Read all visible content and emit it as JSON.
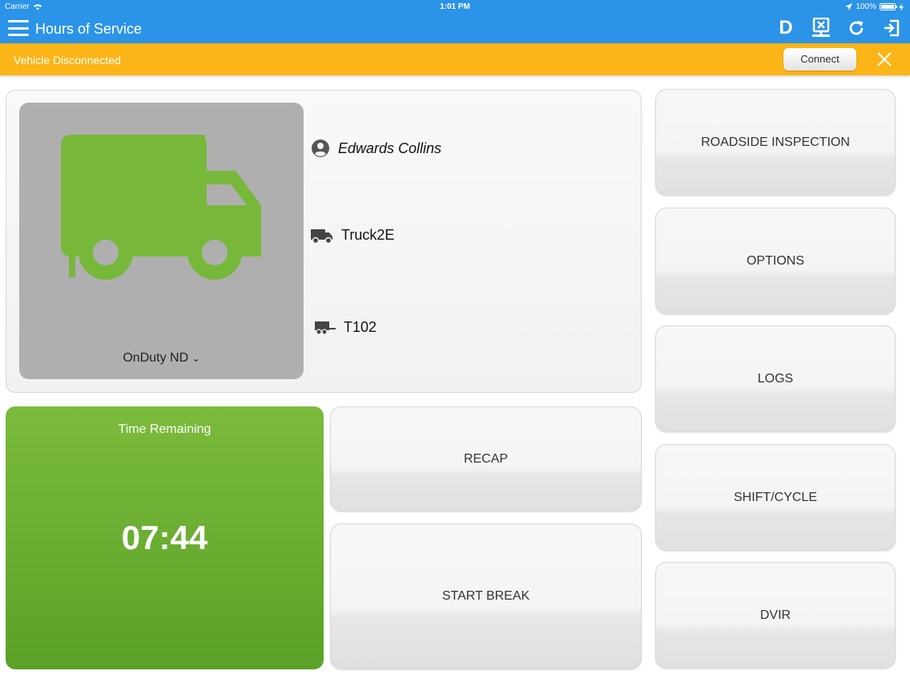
{
  "status_bar": {
    "carrier": "Carrier",
    "time": "1:01 PM",
    "battery": "100%"
  },
  "app_bar": {
    "title": "Hours of Service",
    "icons": [
      "menu-icon",
      "d-icon",
      "disconnect-device-icon",
      "refresh-icon",
      "logout-icon"
    ],
    "d_label": "D"
  },
  "banner": {
    "message": "Vehicle Disconnected",
    "connect_label": "Connect",
    "color": "#fbb517"
  },
  "driver_card": {
    "duty_status": "OnDuty ND",
    "driver_name": "Edwards Collins",
    "truck": "Truck2E",
    "trailer": "T102",
    "truck_color": "#77b83a"
  },
  "time_remaining": {
    "label": "Time Remaining",
    "value": "07:44"
  },
  "buttons": {
    "recap": "RECAP",
    "start_break": "START BREAK",
    "roadside_inspection": "ROADSIDE INSPECTION",
    "options": "OPTIONS",
    "logs": "LOGS",
    "shift_cycle": "SHIFT/CYCLE",
    "dvir": "DVIR"
  },
  "colors": {
    "primary": "#2b93e8",
    "warning": "#fbb517",
    "success": "#6cae30"
  }
}
